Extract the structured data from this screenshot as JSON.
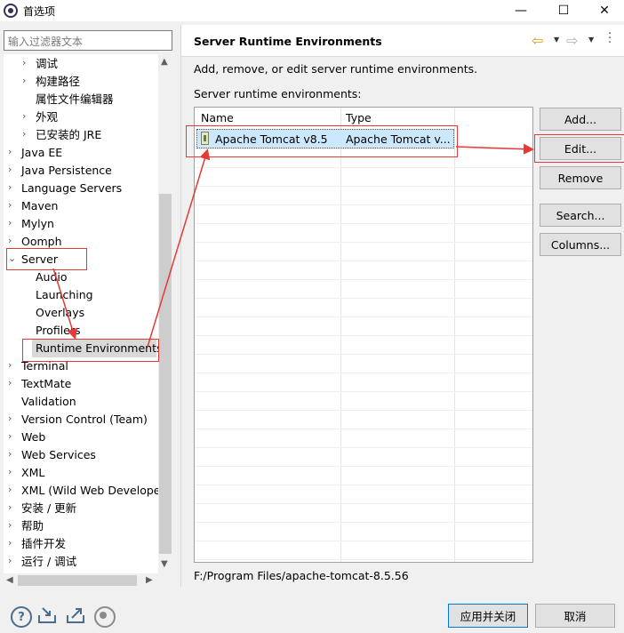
{
  "window": {
    "title": "首选项",
    "minimize": "—",
    "maximize": "☐",
    "close": "✕"
  },
  "filter": {
    "placeholder": "输入过滤器文本"
  },
  "tree": [
    {
      "label": "调试",
      "level": 1,
      "twisty": "collapsed"
    },
    {
      "label": "构建路径",
      "level": 1,
      "twisty": "collapsed"
    },
    {
      "label": "属性文件编辑器",
      "level": 1,
      "twisty": "none"
    },
    {
      "label": "外观",
      "level": 1,
      "twisty": "collapsed"
    },
    {
      "label": "已安装的 JRE",
      "level": 1,
      "twisty": "collapsed"
    },
    {
      "label": "Java EE",
      "level": 0,
      "twisty": "collapsed"
    },
    {
      "label": "Java Persistence",
      "level": 0,
      "twisty": "collapsed"
    },
    {
      "label": "Language Servers",
      "level": 0,
      "twisty": "collapsed"
    },
    {
      "label": "Maven",
      "level": 0,
      "twisty": "collapsed"
    },
    {
      "label": "Mylyn",
      "level": 0,
      "twisty": "collapsed"
    },
    {
      "label": "Oomph",
      "level": 0,
      "twisty": "collapsed"
    },
    {
      "label": "Server",
      "level": 0,
      "twisty": "expanded"
    },
    {
      "label": "Audio",
      "level": 1,
      "twisty": "none"
    },
    {
      "label": "Launching",
      "level": 1,
      "twisty": "none"
    },
    {
      "label": "Overlays",
      "level": 1,
      "twisty": "none"
    },
    {
      "label": "Profilers",
      "level": 1,
      "twisty": "none"
    },
    {
      "label": "Runtime Environments",
      "level": 1,
      "twisty": "none",
      "selected": true
    },
    {
      "label": "Terminal",
      "level": 0,
      "twisty": "collapsed"
    },
    {
      "label": "TextMate",
      "level": 0,
      "twisty": "collapsed"
    },
    {
      "label": "Validation",
      "level": 0,
      "twisty": "none"
    },
    {
      "label": "Version Control (Team)",
      "level": 0,
      "twisty": "collapsed"
    },
    {
      "label": "Web",
      "level": 0,
      "twisty": "collapsed"
    },
    {
      "label": "Web Services",
      "level": 0,
      "twisty": "collapsed"
    },
    {
      "label": "XML",
      "level": 0,
      "twisty": "collapsed"
    },
    {
      "label": "XML (Wild Web Developer",
      "level": 0,
      "twisty": "collapsed"
    },
    {
      "label": "安装 / 更新",
      "level": 0,
      "twisty": "collapsed"
    },
    {
      "label": "帮助",
      "level": 0,
      "twisty": "collapsed"
    },
    {
      "label": "插件开发",
      "level": 0,
      "twisty": "collapsed"
    },
    {
      "label": "运行 / 调试",
      "level": 0,
      "twisty": "collapsed"
    }
  ],
  "panel": {
    "title": "Server Runtime Environments",
    "description": "Add, remove, or edit server runtime environments.",
    "list_label": "Server runtime environments:",
    "columns": [
      "Name",
      "Type"
    ],
    "rows": [
      {
        "name": "Apache Tomcat v8.5",
        "type": "Apache Tomcat v..."
      }
    ],
    "buttons": {
      "add": "Add...",
      "edit": "Edit...",
      "remove": "Remove",
      "search": "Search...",
      "columns": "Columns..."
    },
    "path": "F:/Program Files/apache-tomcat-8.5.56"
  },
  "footer": {
    "apply_close": "应用并关闭",
    "cancel": "取消",
    "help_glyph": "?"
  },
  "colors": {
    "annotation": "#e53935",
    "selection": "#cce8ff",
    "accent": "#0078d7"
  }
}
